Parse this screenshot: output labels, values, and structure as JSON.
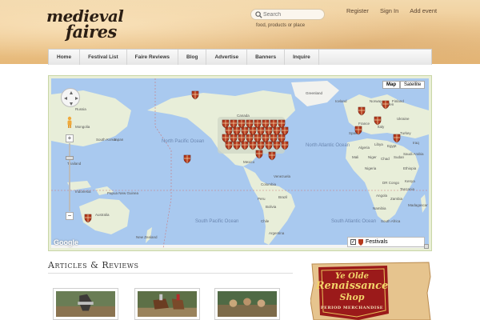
{
  "brand": {
    "line1": "medieval",
    "line2": "faires"
  },
  "search": {
    "placeholder": "Search",
    "hint": "food, products or place"
  },
  "toplinks": [
    "Register",
    "Sign In",
    "Add event"
  ],
  "nav": [
    "Home",
    "Festival List",
    "Faire Reviews",
    "Blog",
    "Advertise",
    "Banners",
    "Inquire"
  ],
  "map": {
    "map_type": [
      "Map",
      "Satellite"
    ],
    "zoom_in": "+",
    "zoom_out": "−",
    "attribution": "Google",
    "legend_label": "Festivals",
    "legend_checked": "✓",
    "ocean_labels": [
      "North Pacific Ocean",
      "North Atlantic Ocean",
      "South Pacific Ocean",
      "South Atlantic Ocean"
    ],
    "country_labels": [
      "Canada",
      "Greenland",
      "Russia",
      "Japan",
      "South Korea",
      "Mongolia",
      "Thailand",
      "Indonesia",
      "Papua New Guinea",
      "Australia",
      "New Zealand",
      "Mexico",
      "Venezuela",
      "Colombia",
      "Peru",
      "Brazil",
      "Bolivia",
      "Chile",
      "Argentina",
      "Iceland",
      "Norway",
      "Sweden",
      "Finland",
      "France",
      "Spain",
      "Italy",
      "Ukraine",
      "Turkey",
      "Iraq",
      "Saudi Arabia",
      "Egypt",
      "Algeria",
      "Libya",
      "Mali",
      "Niger",
      "Chad",
      "Sudan",
      "Nigeria",
      "Ethiopia",
      "DR Congo",
      "Kenya",
      "Tanzania",
      "Angola",
      "Namibia",
      "Zambia",
      "South Africa",
      "Madagascar"
    ]
  },
  "articles": {
    "title": "Articles & Reviews"
  },
  "ad": {
    "line1": "Ye Olde",
    "line2": "Renaissance",
    "line3": "Shop",
    "tagline": "PERIOD MERCHANDISE"
  },
  "colors": {
    "water": "#a8c8f0",
    "land": "#e8eed9",
    "pin": "#b53a1e",
    "pin_dark": "#6b1e10",
    "nav_text": "#3a3a3a"
  }
}
